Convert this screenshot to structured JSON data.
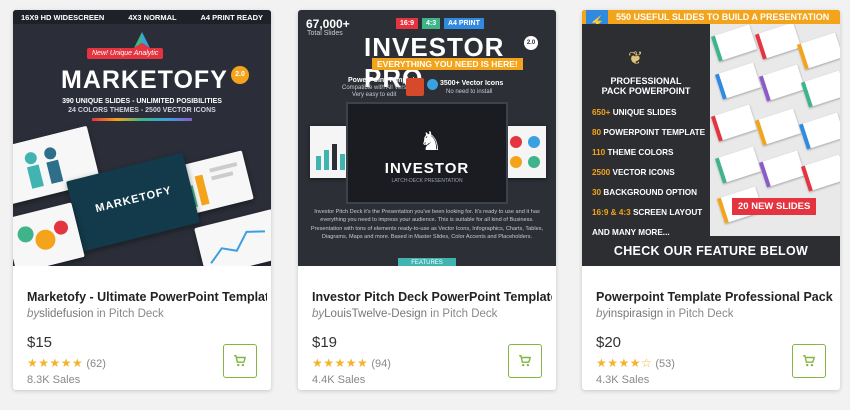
{
  "colors": {
    "accent_green": "#82b541",
    "star": "#f3b32a",
    "orange": "#f3a41a",
    "red": "#e4343f"
  },
  "cards": [
    {
      "title": "Marketofy - Ultimate PowerPoint Template",
      "by": "by",
      "author": "slidefusion",
      "category": "in Pitch Deck",
      "price": "$15",
      "stars": "★★★★★",
      "rating_count": "(62)",
      "sales": "8.3K Sales",
      "cart_icon": "shopping-cart-icon",
      "thumb": {
        "top_labels": [
          "16X9 HD WIDESCREEN",
          "4X3 NORMAL",
          "A4 PRINT READY"
        ],
        "new_tag": "New! Unique Analytic",
        "brand": "MARKETOFY",
        "version": "2.0",
        "sub1": "390 UNIQUE SLIDES - UNLIMITED POSIBILITIES",
        "sub2": "24 COLORS THEMES - 2500 VECTOR ICONS",
        "slide_brand": "MARKETOFY"
      }
    },
    {
      "title": "Investor Pitch Deck PowerPoint Template",
      "by": "by",
      "author": "LouisTwelve-Design",
      "category": "in Pitch Deck",
      "price": "$19",
      "stars": "★★★★★",
      "rating_count": "(94)",
      "sales": "4.4K Sales",
      "cart_icon": "shopping-cart-icon",
      "thumb": {
        "count": "67,000+",
        "count_label": "Total Slides",
        "tags": [
          "16:9",
          "4:3",
          "A4 PRINT"
        ],
        "brand": "INVESTOR PRO",
        "version": "2.0",
        "tagline": "EVERYTHING YOU NEED IS HERE!",
        "pp_title": "PowerPoint Template",
        "pp_line1": "Compatible with All Versions",
        "pp_line2": "Very easy to edit",
        "icons_title": "3500+ Vector Icons",
        "icons_line": "No need to install",
        "screen_title": "INVESTOR",
        "screen_sub": "LATCH-DECK PRESENTATION",
        "description": "Investor Pitch Deck it's the Presentation you've been looking for. It's ready to use and it has everything you need to impress your audience. This is suitable for all kind of Business. Presentation with tons of elements ready-to-use as Vector Icons, Infographics, Charts, Tables, Diagrams, Maps and more. Based in Master Slides, Color Accents and Placeholders.",
        "features": "FEATURES"
      }
    },
    {
      "title": "Powerpoint Template Professional Pack",
      "by": "by",
      "author": "inspirasign",
      "category": "in Pitch Deck",
      "price": "$20",
      "stars": "★★★★☆",
      "rating_count": "(53)",
      "sales": "4.3K Sales",
      "cart_icon": "shopping-cart-icon",
      "thumb": {
        "banner": "550 USEFUL SLIDES TO BUILD A PRESENTATION",
        "pro1": "PROFESSIONAL",
        "pro2": "PACK POWERPOINT",
        "features": [
          {
            "hl": "650+",
            "text": " UNIQUE SLIDES"
          },
          {
            "hl": "80",
            "text": " POWERPOINT TEMPLATE"
          },
          {
            "hl": "110",
            "text": " THEME COLORS"
          },
          {
            "hl": "2500",
            "text": " VECTOR ICONS"
          },
          {
            "hl": "30",
            "text": " BACKGROUND OPTION"
          },
          {
            "hl": "16:9 & 4:3",
            "text": " SCREEN LAYOUT"
          },
          {
            "hl": "",
            "text": "AND MANY MORE..."
          }
        ],
        "new_slides": "20 NEW SLIDES",
        "bottom": "CHECK OUR FEATURE BELOW"
      }
    }
  ]
}
